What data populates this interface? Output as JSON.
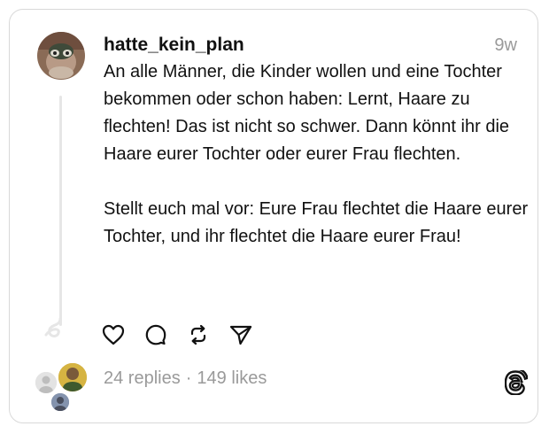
{
  "post": {
    "username": "hatte_kein_plan",
    "time": "9w",
    "paragraphs": [
      "An alle Männer, die Kinder wollen und eine Tochter bekommen oder schon haben: Lernt, Haare zu flechten! Das ist nicht so schwer. Dann könnt ihr die Haare eurer Tochter oder eurer Frau flechten.",
      "Stellt euch mal vor: Eure Frau flechtet die Haare eurer Tochter, und ihr flechtet die Haare eurer Frau!"
    ]
  },
  "actions": {
    "like_icon": "heart-icon",
    "reply_icon": "comment-icon",
    "repost_icon": "repost-icon",
    "share_icon": "send-icon"
  },
  "stats": {
    "replies": "24 replies",
    "separator": "·",
    "likes": "149 likes"
  },
  "brand": {
    "logo_icon": "threads-logo-icon"
  },
  "colors": {
    "text": "#111111",
    "muted": "#9a9a9a",
    "border": "#d9d9d9",
    "thread_line": "#e6e6e6"
  }
}
